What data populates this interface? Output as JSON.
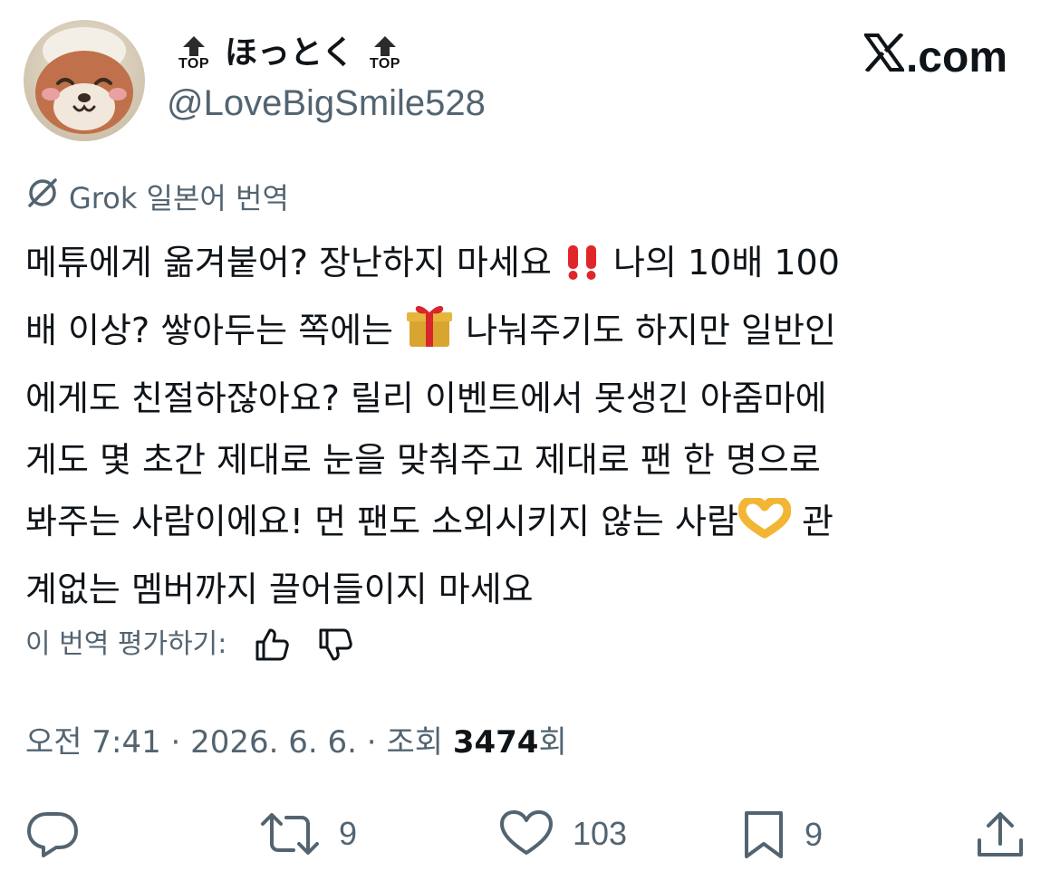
{
  "user": {
    "display_name": "ほっとく",
    "handle": "@LoveBigSmile528",
    "badge_text": "TOP",
    "badge_icon": "top-arrow-icon",
    "avatar": "avatar-image"
  },
  "brand": {
    "label": ".com"
  },
  "translation": {
    "label": "Grok 일본어 번역",
    "icon": "grok-icon"
  },
  "tweet": {
    "lines": [
      "메튜에게 옮겨붙어? 장난하지 마세요",
      " 나의 10배 100",
      "배 이상? 쌓아두는 쪽에는 ",
      " 나눠주기도 하지만 일반인",
      "에게도 친절하잖아요? 릴리 이벤트에서 못생긴 아줌마에",
      "게도 몇 초간 제대로 눈을 맞춰주고 제대로 팬 한 명으로",
      "봐주는 사람이에요! 먼 팬도 소외시키지 않는 사람",
      " 관",
      "계없는 멤버까지 끌어들이지 마세요"
    ],
    "emojis": [
      "double-exclamation-emoji",
      "gift-emoji",
      "heart-hands-emoji"
    ]
  },
  "rating": {
    "label": "이 번역 평가하기:",
    "up_icon": "thumbs-up-icon",
    "down_icon": "thumbs-down-icon"
  },
  "meta": {
    "time": "오전 7:41",
    "separator": " · ",
    "date": "2026. 6. 6.",
    "views_label": "조회 ",
    "views_count": "3474",
    "views_suffix": "회"
  },
  "actions": {
    "reply": {
      "icon": "reply-icon",
      "count": ""
    },
    "repost": {
      "icon": "repost-icon",
      "count": "9"
    },
    "like": {
      "icon": "heart-icon",
      "count": "103"
    },
    "bookmark": {
      "icon": "bookmark-icon",
      "count": "9"
    },
    "share": {
      "icon": "share-icon",
      "count": ""
    }
  },
  "colors": {
    "text_primary": "#0f1419",
    "text_secondary": "#536471",
    "icon": "#536471"
  }
}
